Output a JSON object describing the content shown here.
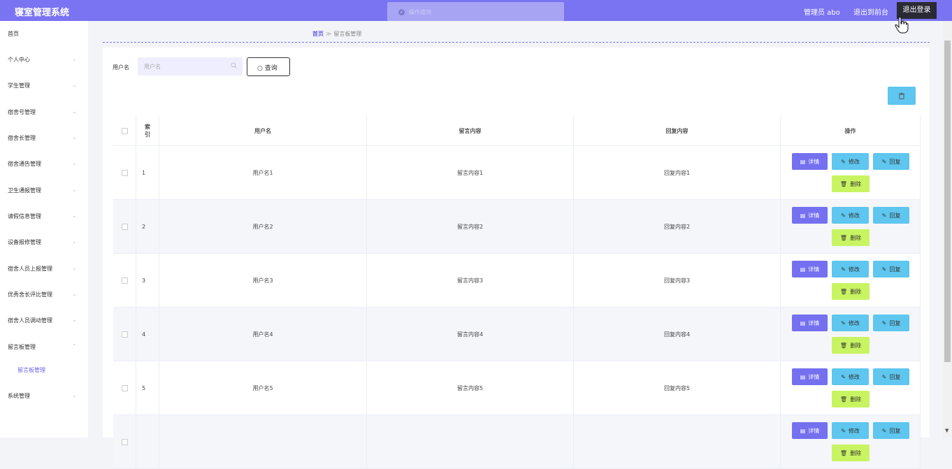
{
  "app_title": "寝室管理系统",
  "toast": {
    "text": "操作成功"
  },
  "header": {
    "admin_label": "管理员 abo",
    "back_front": "退出到前台",
    "logout": "退出登录"
  },
  "sidebar": {
    "items": [
      {
        "label": "首页",
        "arrow": ""
      },
      {
        "label": "个人中心",
        "arrow": "⌄"
      },
      {
        "label": "学生管理",
        "arrow": "⌄"
      },
      {
        "label": "宿舍号管理",
        "arrow": "⌄"
      },
      {
        "label": "宿舍长管理",
        "arrow": "⌄"
      },
      {
        "label": "宿舍通告管理",
        "arrow": "⌄"
      },
      {
        "label": "卫生通报管理",
        "arrow": "⌄"
      },
      {
        "label": "请假信息管理",
        "arrow": "⌄"
      },
      {
        "label": "设备报修管理",
        "arrow": "⌄"
      },
      {
        "label": "宿舍人员上报管理",
        "arrow": "⌄"
      },
      {
        "label": "优秀舍长评比管理",
        "arrow": "⌄"
      },
      {
        "label": "宿舍人员调动管理",
        "arrow": "⌄"
      },
      {
        "label": "留言板管理",
        "arrow": "⌃"
      },
      {
        "label": "系统管理",
        "arrow": "⌄"
      }
    ],
    "submenu_item": "留言板管理"
  },
  "breadcrumb": {
    "home": "首页",
    "separator": "≫",
    "current": "留言板管理"
  },
  "search": {
    "label": "用户名",
    "placeholder": "用户名",
    "button": "查询"
  },
  "table": {
    "headers": [
      "",
      "索引",
      "用户名",
      "留言内容",
      "回复内容",
      "操作"
    ],
    "rows": [
      {
        "index": "1",
        "username": "用户名1",
        "message": "留言内容1",
        "reply": "回复内容1"
      },
      {
        "index": "2",
        "username": "用户名2",
        "message": "留言内容2",
        "reply": "回复内容2"
      },
      {
        "index": "3",
        "username": "用户名3",
        "message": "留言内容3",
        "reply": "回复内容3"
      },
      {
        "index": "4",
        "username": "用户名4",
        "message": "留言内容4",
        "reply": "回复内容4"
      },
      {
        "index": "5",
        "username": "用户名5",
        "message": "留言内容5",
        "reply": "回复内容5"
      },
      {
        "index": "",
        "username": "",
        "message": "",
        "reply": ""
      }
    ],
    "actions": {
      "detail": "详情",
      "edit": "修改",
      "reply": "回复",
      "delete": "删除"
    }
  },
  "colors": {
    "primary": "#7a73f2",
    "info": "#5ec6ef",
    "danger_light": "#c8f462",
    "detail": "#7470f0"
  }
}
